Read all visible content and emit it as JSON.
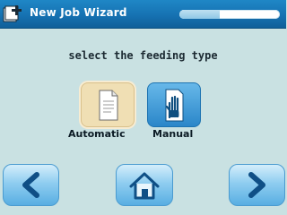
{
  "header": {
    "title": "New Job Wizard",
    "icon": "new-job-wizard-icon",
    "progress": 0.4
  },
  "prompt": "select the feeding type",
  "options": [
    {
      "label": "Automatic",
      "icon": "document-icon",
      "selected": true
    },
    {
      "label": "Manual",
      "icon": "hand-icon",
      "selected": false
    }
  ],
  "nav": {
    "back_icon": "chevron-left-icon",
    "home_icon": "home-icon",
    "next_icon": "chevron-right-icon"
  },
  "colors": {
    "header_bg": "#1672b2",
    "body_bg": "#c9e1e2",
    "selected_option_bg": "#f0dfb4",
    "option_bg": "#2a86c9",
    "nav_button": "#58aee2"
  }
}
